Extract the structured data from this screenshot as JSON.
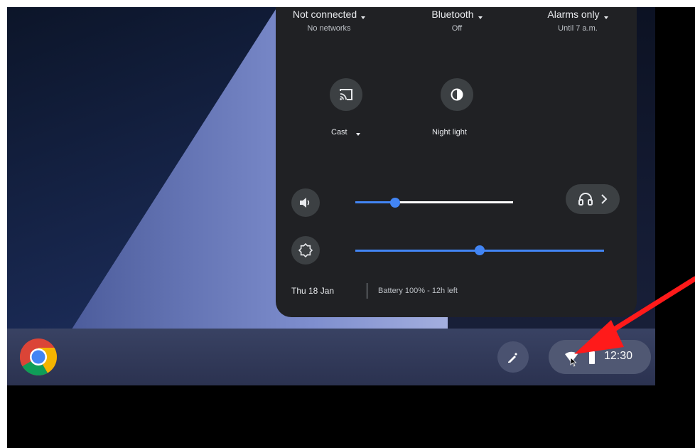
{
  "quick_settings": {
    "network": {
      "title": "Not connected",
      "subtitle": "No networks"
    },
    "bluetooth": {
      "title": "Bluetooth",
      "subtitle": "Off"
    },
    "notifications": {
      "title": "Alarms only",
      "subtitle": "Until 7 a.m."
    },
    "cast_label": "Cast",
    "night_light_label": "Night light",
    "volume_level": 0.2,
    "brightness_level": 0.5,
    "date": "Thu 18 Jan",
    "battery": "Battery 100% - 12h left"
  },
  "shelf": {
    "clock": "12:30",
    "icons": [
      "chrome-icon",
      "stylus-icon",
      "wifi-icon",
      "battery-icon"
    ]
  },
  "annotation": {
    "arrow_color": "#ff1a1a"
  },
  "colors": {
    "accent": "#4285f4",
    "panel": "#202124"
  }
}
